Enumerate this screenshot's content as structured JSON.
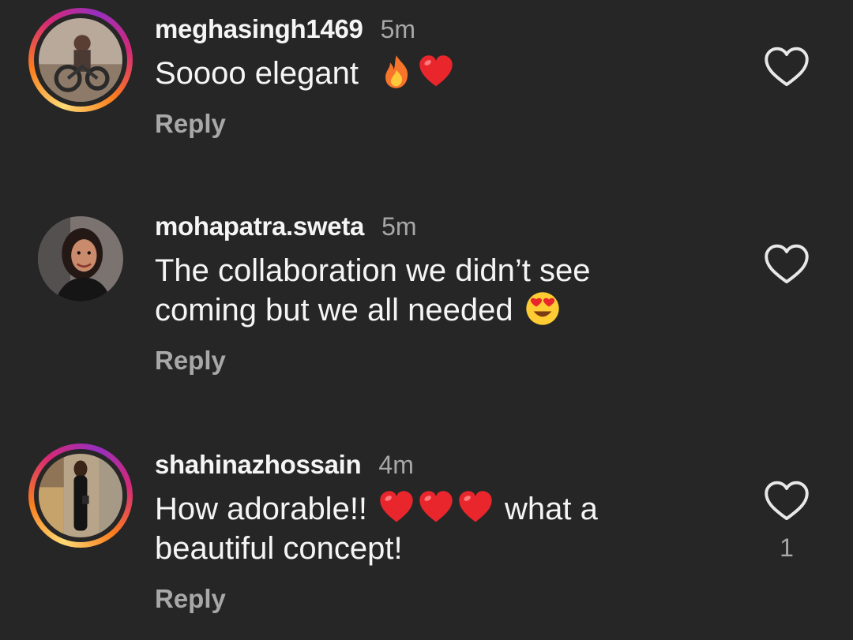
{
  "comments": [
    {
      "username": "meghasingh1469",
      "time": "5m",
      "text": "Soooo elegant",
      "emojis": [
        "fire-emoji",
        "red-heart-emoji"
      ],
      "reply": "Reply",
      "story_ring": true,
      "like_icon": "heart-outline-icon"
    },
    {
      "username": "mohapatra.sweta",
      "time": "5m",
      "text_line1": "The collaboration we didn’t see",
      "text_line2": "coming but we all needed",
      "emojis": [
        "heart-eyes-emoji"
      ],
      "reply": "Reply",
      "story_ring": false,
      "like_icon": "heart-outline-icon"
    },
    {
      "username": "shahinazhossain",
      "time": "4m",
      "text_part1": "How adorable!!",
      "text_part2": "what a",
      "text_line2": "beautiful concept!",
      "emojis": [
        "red-heart-emoji",
        "red-heart-emoji",
        "red-heart-emoji"
      ],
      "reply": "Reply",
      "like_count": "1",
      "story_ring": true,
      "like_icon": "heart-outline-icon"
    }
  ],
  "colors": {
    "background": "#262626",
    "primary_text": "#f5f5f5",
    "secondary_text": "#a8a8a8",
    "heart_emoji": "#e8262c"
  }
}
